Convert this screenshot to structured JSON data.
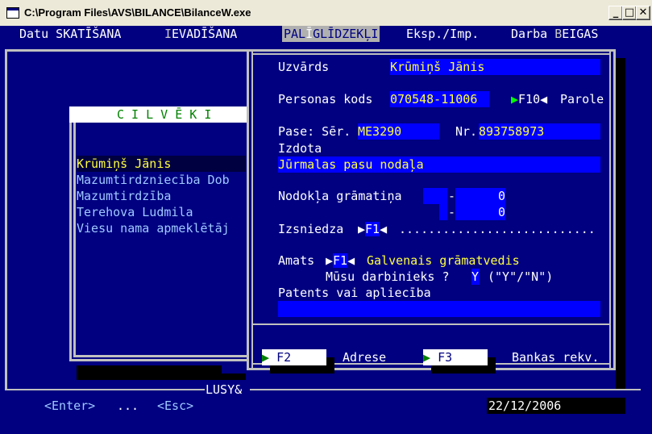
{
  "window": {
    "title": "C:\\Program Files\\AVS\\BILANCE\\BilanceW.exe",
    "minimize": "_",
    "maximize": "□",
    "close": "✕"
  },
  "menu": [
    {
      "pre": "Datu ",
      "hot": "S",
      "post": "KATĪŠANA"
    },
    {
      "pre": "",
      "hot": "I",
      "post": "EVADĪŠANA"
    },
    {
      "pre": "PAL",
      "hot": "Ī",
      "post": "GLĪDZEKĻI"
    },
    {
      "pre": "Eksp./Imp.",
      "hot": "",
      "post": ""
    },
    {
      "pre": "Darba ",
      "hot": "B",
      "post": "EIGAS"
    }
  ],
  "left_panel": {
    "header": "C I L V Ē K I",
    "items": [
      "Krūmiņš Jānis",
      "Mazumtirdzniecība Dob",
      "Mazumtirdzība",
      "Terehova Ludmila",
      "Viesu nama apmeklētāj"
    ],
    "bottom_label": "LUSY&",
    "enter": "<Enter>",
    "dots": "...",
    "esc": "<Esc>",
    "date": "22/12/2006"
  },
  "form": {
    "surname_label": "Uzvārds",
    "surname_value": "Krūmiņš Jānis",
    "code_label": "Personas kods",
    "code_value": "070548-11006",
    "f10_tri_l": "▶",
    "f10_label": "F10",
    "f10_tri_r": "◀",
    "parole_label": "Parole",
    "pase_label": "Pase: Sēr.",
    "pase_series": "ME3290",
    "nr_label": "Nr.",
    "pase_number": "893758973",
    "izdota_label": "Izdota",
    "izdota_value": "Jūrmalas pasu nodaļa",
    "tax_label": "Nodokļa grāmatiņa",
    "tax_dash1": "-",
    "tax_val1": "0",
    "tax_dash2": "-",
    "tax_val2": "0",
    "issuer_label": "Izsniedza",
    "f1_tri_l": "▶",
    "f1_label": "F1",
    "f1_tri_r": "◀",
    "issuer_dots": "...........................",
    "amats_label": "Amats",
    "amats_value": "Galvenais grāmatvedis",
    "employee_label": "Mūsu darbinieks ?",
    "employee_value": "Y",
    "employee_hint": "(\"Y\"/\"N\")",
    "patents_label": "Patents vai apliecība",
    "patents_value": "",
    "f2_label": "F2",
    "f2_desc": "Adrese",
    "f3_label": "F3",
    "f3_desc": "Bankas rekv.",
    "btn_tri": "▶"
  },
  "colors": {
    "bg": "#000080",
    "field": "#0000FF",
    "field_text": "#FFFF40",
    "line": "#C0C0C0",
    "hilite": "#FFFF40"
  }
}
